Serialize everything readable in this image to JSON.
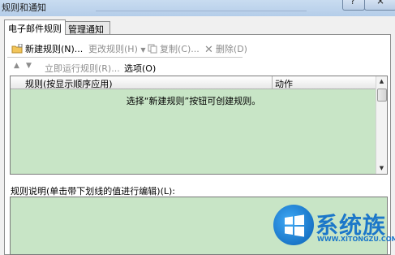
{
  "window": {
    "title": "规则和通知",
    "help_symbol": "?",
    "close_symbol": "×"
  },
  "tabs": [
    {
      "label": "电子邮件规则",
      "active": true
    },
    {
      "label": "管理通知",
      "active": false
    }
  ],
  "toolbar": {
    "new_rule": "新建规则(N)...",
    "change_rule": "更改规则(H)",
    "copy": "复制(C)...",
    "delete": "删除(D)",
    "run_now": "立即运行规则(R)...",
    "options": "选项(O)"
  },
  "rules_list": {
    "columns": [
      "规则(按显示顺序应用)",
      "动作"
    ],
    "empty_message": "选择“新建规则”按钮可创建规则。"
  },
  "description": {
    "label": "规则说明(单击带下划线的值进行编辑)(L):"
  },
  "watermark": {
    "text": "系统族",
    "url": "WWW.XITONGZU.COM"
  },
  "colors": {
    "list_background": "#c8e5c6",
    "accent": "#1c77c9"
  }
}
